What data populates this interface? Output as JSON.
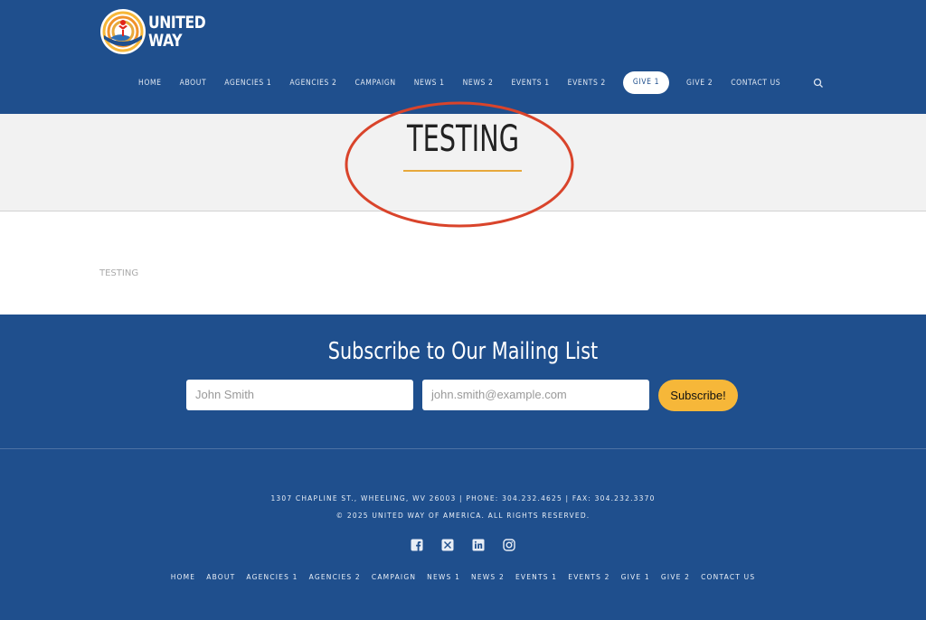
{
  "brand": {
    "line1": "UNITED",
    "line2": "WAY"
  },
  "nav": {
    "items": [
      "HOME",
      "ABOUT",
      "AGENCIES 1",
      "AGENCIES 2",
      "CAMPAIGN",
      "NEWS 1",
      "NEWS 2",
      "EVENTS 1",
      "EVENTS 2",
      "GIVE 1",
      "GIVE 2",
      "CONTACT US"
    ],
    "active": "GIVE 1",
    "search_icon": "search-icon"
  },
  "page": {
    "title": "TESTING",
    "body_text": "TESTING"
  },
  "subscribe": {
    "title": "Subscribe to Our Mailing List",
    "name_placeholder": "John Smith",
    "email_placeholder": "john.smith@example.com",
    "button_label": "Subscribe!"
  },
  "footer": {
    "address": "1307 CHAPLINE ST., WHEELING, WV 26003 | PHONE: 304.232.4625 | FAX: 304.232.3370",
    "copyright": "© 2025 UNITED WAY OF AMERICA. ALL RIGHTS RESERVED.",
    "social": [
      "facebook-icon",
      "x-icon",
      "linkedin-icon",
      "instagram-icon"
    ],
    "nav": [
      "HOME",
      "ABOUT",
      "AGENCIES 1",
      "AGENCIES 2",
      "CAMPAIGN",
      "NEWS 1",
      "NEWS 2",
      "EVENTS 1",
      "EVENTS 2",
      "GIVE 1",
      "GIVE 2",
      "CONTACT US"
    ]
  },
  "colors": {
    "brand_blue": "#1f4f8d",
    "accent_gold": "#f6b739",
    "annotation_red": "#d9442b"
  }
}
